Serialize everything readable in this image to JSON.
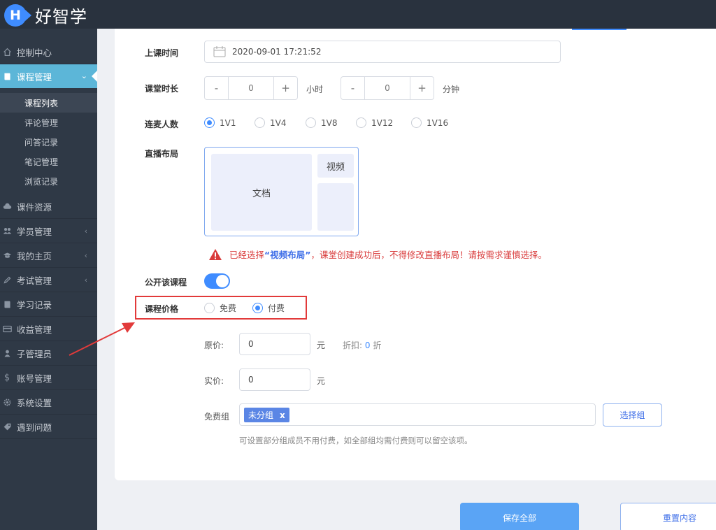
{
  "app": {
    "logo_letter": "H",
    "brand": "好智学"
  },
  "sidebar": {
    "items": [
      {
        "label": "控制中心",
        "icon": "home-icon"
      },
      {
        "label": "课程管理",
        "icon": "book-icon",
        "chevron": "⌄"
      },
      {
        "label": "课件资源",
        "icon": "cloud-icon"
      },
      {
        "label": "学员管理",
        "icon": "users-icon",
        "chevron": "‹"
      },
      {
        "label": "我的主页",
        "icon": "graduation-cap-icon",
        "chevron": "‹"
      },
      {
        "label": "考试管理",
        "icon": "pencil-icon",
        "chevron": "‹"
      },
      {
        "label": "学习记录",
        "icon": "notebook-icon"
      },
      {
        "label": "收益管理",
        "icon": "card-icon"
      },
      {
        "label": "子管理员",
        "icon": "admin-icon"
      },
      {
        "label": "账号管理",
        "icon": "dollar-icon"
      },
      {
        "label": "系统设置",
        "icon": "gear-icon"
      },
      {
        "label": "遇到问题",
        "icon": "tag-icon"
      }
    ],
    "subitems": [
      "课程列表",
      "评论管理",
      "问答记录",
      "笔记管理",
      "浏览记录"
    ]
  },
  "form": {
    "start_time": {
      "label": "上课时间",
      "value": "2020-09-01 17:21:52"
    },
    "duration": {
      "label": "课堂时长",
      "hours": {
        "minus": "-",
        "value": "0",
        "plus": "+",
        "unit": "小时"
      },
      "minutes": {
        "minus": "-",
        "value": "0",
        "plus": "+",
        "unit": "分钟"
      }
    },
    "mic_count": {
      "label": "连麦人数",
      "options": [
        "1V1",
        "1V4",
        "1V8",
        "1V12",
        "1V16"
      ],
      "selected": "1V1"
    },
    "live_layout": {
      "label": "直播布局",
      "doc": "文档",
      "video": "视频",
      "warning_prefix": "已经选择",
      "warning_highlight": "“视频布局”",
      "warning_suffix": "，课堂创建成功后，不得修改直播布局！请按需求谨慎选择。"
    },
    "public_course": {
      "label": "公开该课程",
      "on": true
    },
    "price": {
      "label": "课程价格",
      "options": [
        "免费",
        "付费"
      ],
      "selected": "付费"
    },
    "original_price": {
      "label": "原价:",
      "value": "0",
      "unit": "元",
      "discount_label": "折扣:",
      "discount_value": "0",
      "discount_unit": "折"
    },
    "actual_price": {
      "label": "实价:",
      "value": "0",
      "unit": "元"
    },
    "free_group": {
      "label": "免费组",
      "tag": "未分组",
      "tag_remove": "x",
      "select_button": "选择组",
      "hint": "可设置部分组成员不用付费，如全部组均需付费则可以留空该项。"
    }
  },
  "actions": {
    "save": "保存全部",
    "reset": "重置内容"
  },
  "colors": {
    "primary": "#3f8cff",
    "sidebar": "#2f3946",
    "active": "#5cb6d8",
    "annotation": "#e23a3a"
  }
}
